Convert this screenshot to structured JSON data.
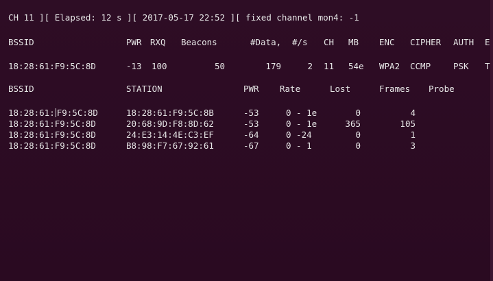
{
  "status_line": {
    "channel": "CH 11",
    "elapsed": "Elapsed: 12 s",
    "datetime": "2017-05-17 22:52",
    "fixed": "fixed channel mon4: -1"
  },
  "ap_table": {
    "headers": {
      "bssid": "BSSID",
      "pwr": "PWR",
      "rxq": "RXQ",
      "beacons": "Beacons",
      "data": "#Data,",
      "per_s": "#/s",
      "ch": "CH",
      "mb": "MB",
      "enc": "ENC",
      "cipher": "CIPHER",
      "auth": "AUTH",
      "essid": "E"
    },
    "rows": [
      {
        "bssid": "18:28:61:F9:5C:8D",
        "pwr": "-13",
        "rxq": "100",
        "beacons": "50",
        "data": "179",
        "per_s": "2",
        "ch": "11",
        "mb": "54e",
        "enc": "WPA2",
        "cipher": "CCMP",
        "auth": "PSK",
        "essid": "T"
      }
    ]
  },
  "station_table": {
    "headers": {
      "bssid": "BSSID",
      "station": "STATION",
      "pwr": "PWR",
      "rate": "Rate",
      "lost": "Lost",
      "frames": "Frames",
      "probe": "Probe"
    },
    "rows": [
      {
        "bssid_a": "18:28:61:",
        "bssid_b": "F9:5C:8D",
        "station": "18:28:61:F9:5C:8B",
        "pwr": "-53",
        "rate": "0 - 1e",
        "lost": "0",
        "frames": "4"
      },
      {
        "bssid": "18:28:61:F9:5C:8D",
        "station": "20:68:9D:F8:8D:62",
        "pwr": "-53",
        "rate": "0 - 1e",
        "lost": "365",
        "frames": "105"
      },
      {
        "bssid": "18:28:61:F9:5C:8D",
        "station": "24:E3:14:4E:C3:EF",
        "pwr": "-64",
        "rate": "0 -24",
        "lost": "0",
        "frames": "1"
      },
      {
        "bssid": "18:28:61:F9:5C:8D",
        "station": "B8:98:F7:67:92:61",
        "pwr": "-67",
        "rate": "0 - 1",
        "lost": "0",
        "frames": "3"
      }
    ]
  }
}
